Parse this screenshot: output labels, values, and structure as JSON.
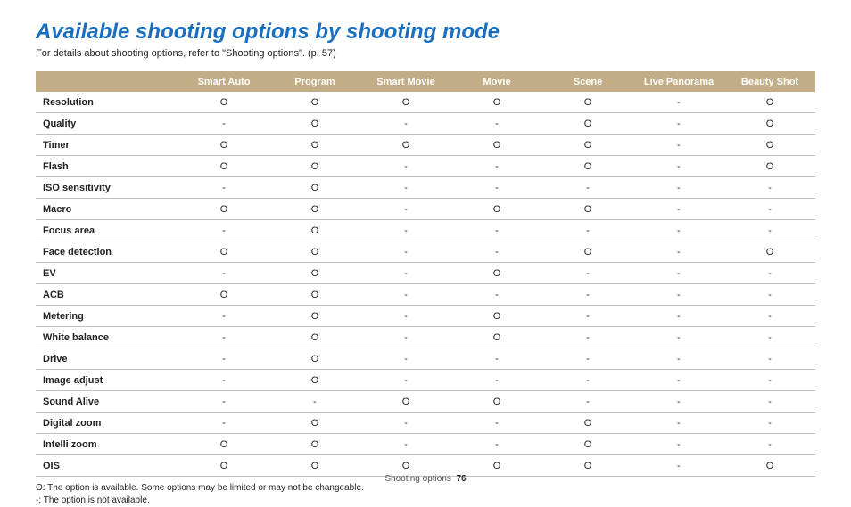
{
  "title": "Available shooting options by shooting mode",
  "subtitle": "For details about shooting options, refer to \"Shooting options\". (p. 57)",
  "columns": [
    "Smart Auto",
    "Program",
    "Smart Movie",
    "Movie",
    "Scene",
    "Live Panorama",
    "Beauty Shot"
  ],
  "rows": [
    {
      "label": "Resolution",
      "cells": [
        "O",
        "O",
        "O",
        "O",
        "O",
        "-",
        "O"
      ]
    },
    {
      "label": "Quality",
      "cells": [
        "-",
        "O",
        "-",
        "-",
        "O",
        "-",
        "O"
      ]
    },
    {
      "label": "Timer",
      "cells": [
        "O",
        "O",
        "O",
        "O",
        "O",
        "-",
        "O"
      ]
    },
    {
      "label": "Flash",
      "cells": [
        "O",
        "O",
        "-",
        "-",
        "O",
        "-",
        "O"
      ]
    },
    {
      "label": "ISO sensitivity",
      "cells": [
        "-",
        "O",
        "-",
        "-",
        "-",
        "-",
        "-"
      ]
    },
    {
      "label": "Macro",
      "cells": [
        "O",
        "O",
        "-",
        "O",
        "O",
        "-",
        "-"
      ]
    },
    {
      "label": "Focus area",
      "cells": [
        "-",
        "O",
        "-",
        "-",
        "-",
        "-",
        "-"
      ]
    },
    {
      "label": "Face detection",
      "cells": [
        "O",
        "O",
        "-",
        "-",
        "O",
        "-",
        "O"
      ]
    },
    {
      "label": "EV",
      "cells": [
        "-",
        "O",
        "-",
        "O",
        "-",
        "-",
        "-"
      ]
    },
    {
      "label": "ACB",
      "cells": [
        "O",
        "O",
        "-",
        "-",
        "-",
        "-",
        "-"
      ]
    },
    {
      "label": "Metering",
      "cells": [
        "-",
        "O",
        "-",
        "O",
        "-",
        "-",
        "-"
      ]
    },
    {
      "label": "White balance",
      "cells": [
        "-",
        "O",
        "-",
        "O",
        "-",
        "-",
        "-"
      ]
    },
    {
      "label": "Drive",
      "cells": [
        "-",
        "O",
        "-",
        "-",
        "-",
        "-",
        "-"
      ]
    },
    {
      "label": "Image adjust",
      "cells": [
        "-",
        "O",
        "-",
        "-",
        "-",
        "-",
        "-"
      ]
    },
    {
      "label": "Sound Alive",
      "cells": [
        "-",
        "-",
        "O",
        "O",
        "-",
        "-",
        "-"
      ]
    },
    {
      "label": "Digital zoom",
      "cells": [
        "-",
        "O",
        "-",
        "-",
        "O",
        "-",
        "-"
      ]
    },
    {
      "label": "Intelli zoom",
      "cells": [
        "O",
        "O",
        "-",
        "-",
        "O",
        "-",
        "-"
      ]
    },
    {
      "label": "OIS",
      "cells": [
        "O",
        "O",
        "O",
        "O",
        "O",
        "-",
        "O"
      ]
    }
  ],
  "notes": [
    "O: The option is available. Some options may be limited or may not be changeable.",
    "-: The option is not available."
  ],
  "footer": {
    "section": "Shooting options",
    "page": "76"
  }
}
